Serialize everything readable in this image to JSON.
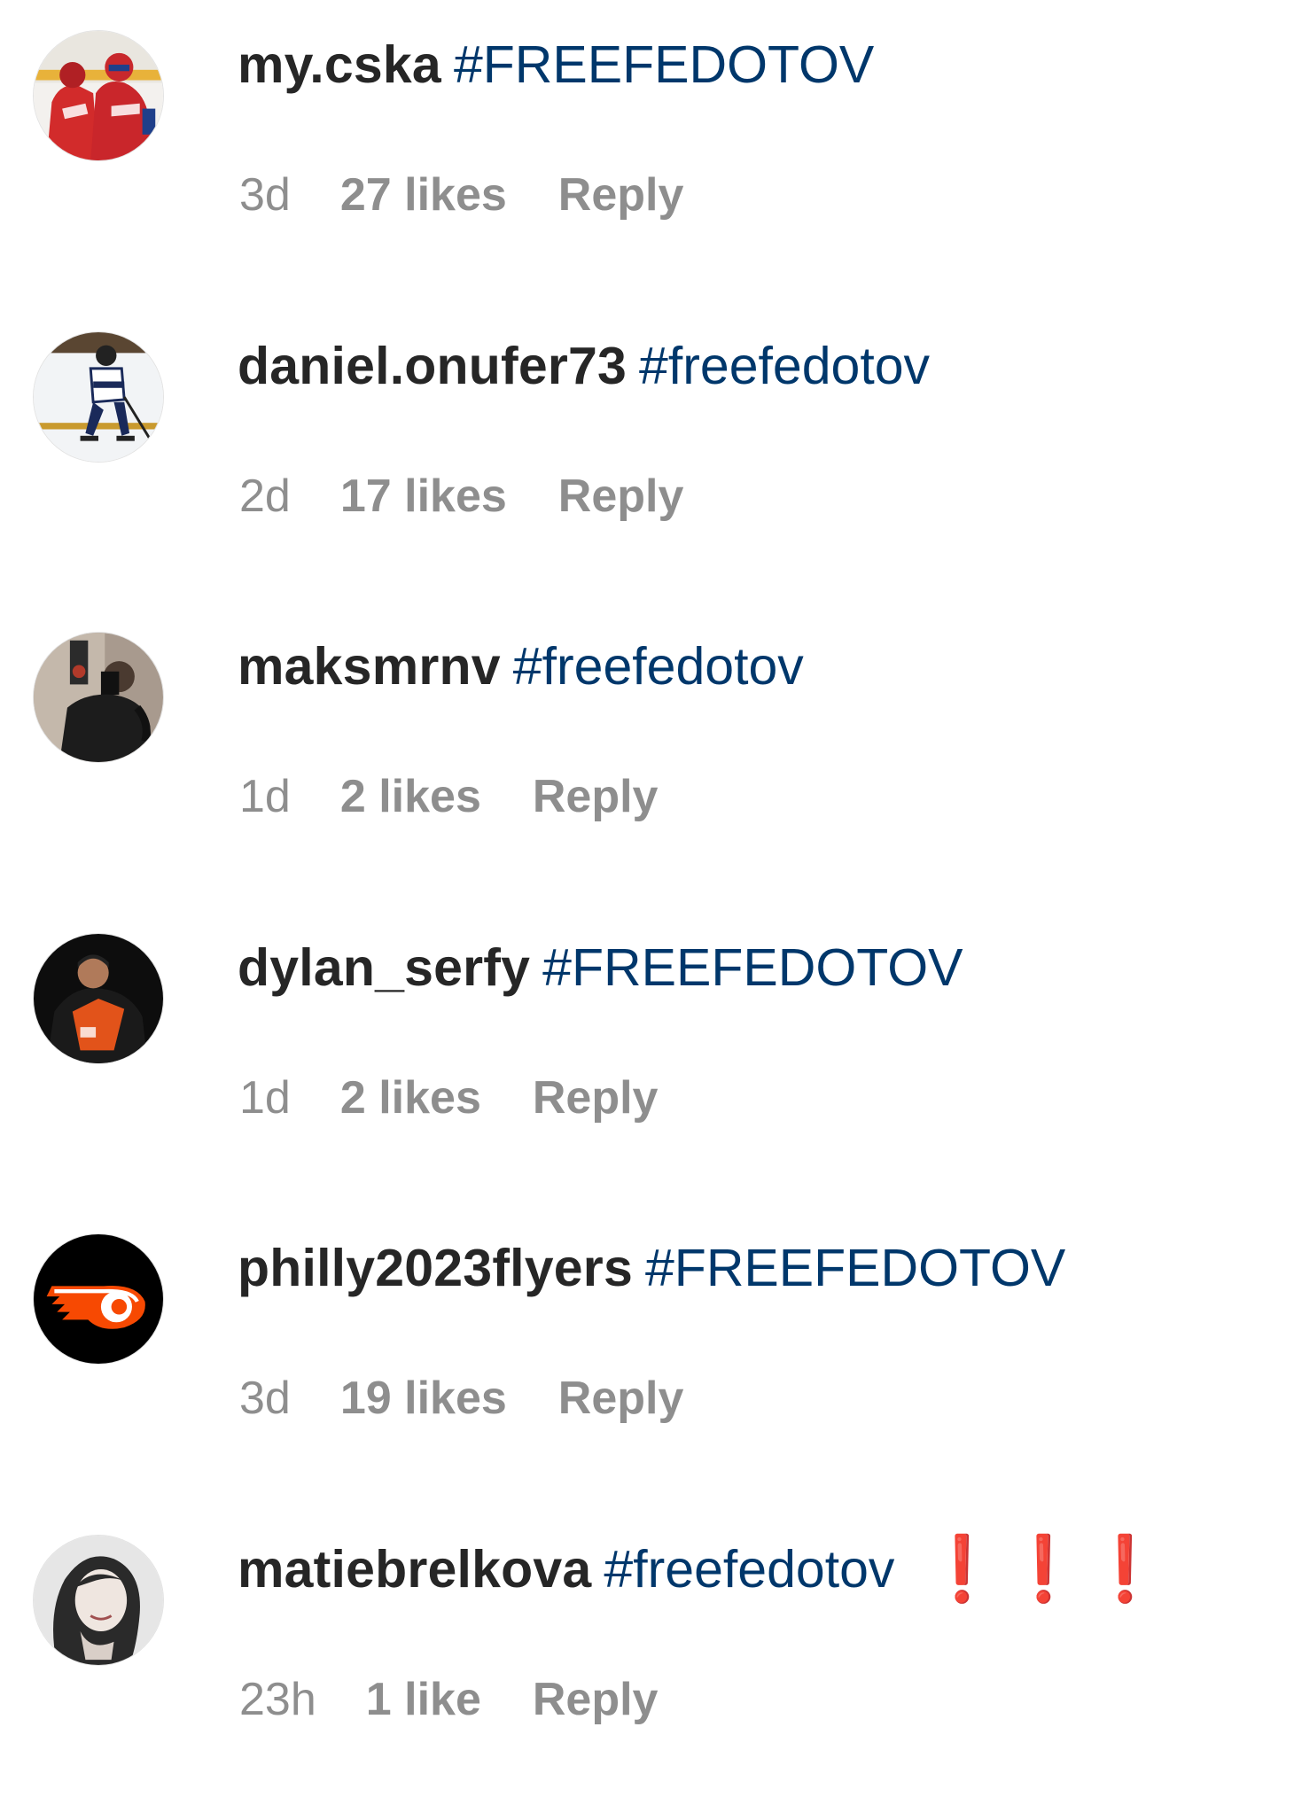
{
  "comments": [
    {
      "username": "my.cska",
      "text": "#FREEFEDOTOV",
      "time": "3d",
      "likes": "27 likes",
      "reply_label": "Reply",
      "avatar_icon": "hockey-players-red-avatar"
    },
    {
      "username": "daniel.onufer73",
      "text": "#freefedotov",
      "time": "2d",
      "likes": "17 likes",
      "reply_label": "Reply",
      "avatar_icon": "hockey-skater-on-ice-avatar"
    },
    {
      "username": "maksmrnv",
      "text": "#freefedotov",
      "time": "1d",
      "likes": "2 likes",
      "reply_label": "Reply",
      "avatar_icon": "mirror-selfie-avatar"
    },
    {
      "username": "dylan_serfy",
      "text": "#FREEFEDOTOV",
      "time": "1d",
      "likes": "2 likes",
      "reply_label": "Reply",
      "avatar_icon": "flyers-player-dylan-avatar"
    },
    {
      "username": "philly2023flyers",
      "text": "#FREEFEDOTOV",
      "time": "3d",
      "likes": "19 likes",
      "reply_label": "Reply",
      "avatar_icon": "flyers-logo-avatar"
    },
    {
      "username": "matiebrelkova",
      "text": "#freefedotov",
      "emoji": [
        "❗",
        "❗",
        "❗"
      ],
      "time": "23h",
      "likes": "1 like",
      "reply_label": "Reply",
      "avatar_icon": "portrait-bw-avatar"
    }
  ],
  "colors": {
    "username": "#262626",
    "hashtag": "#00376b",
    "meta": "#8e8e8e",
    "exclamation": "#e0201b",
    "flyers_orange": "#f74902"
  }
}
